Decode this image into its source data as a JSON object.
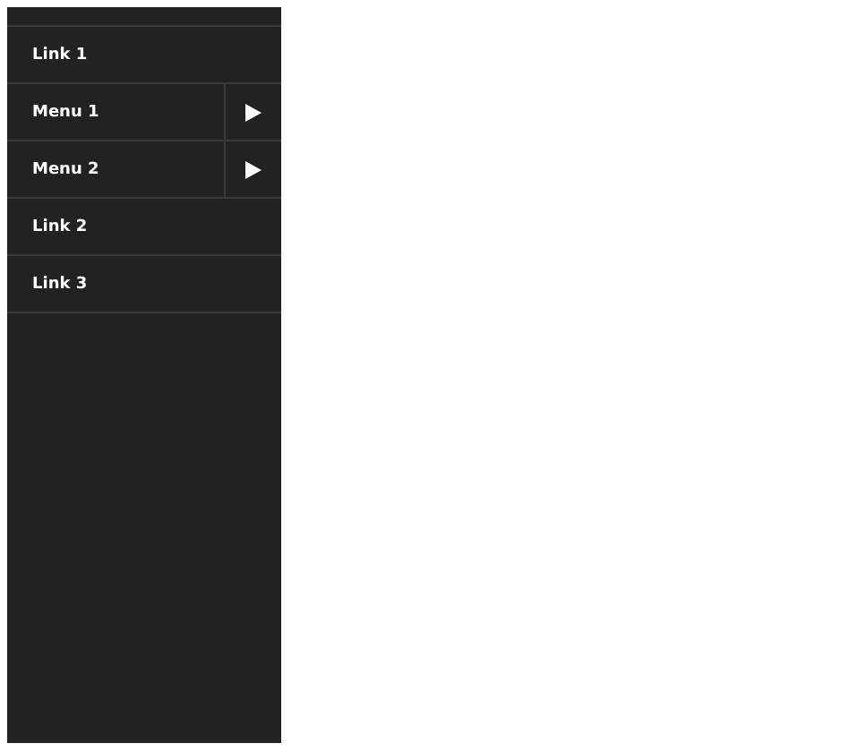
{
  "sidebar": {
    "items": [
      {
        "kind": "link",
        "label": "Link 1"
      },
      {
        "kind": "menu",
        "label": "Menu 1"
      },
      {
        "kind": "menu",
        "label": "Menu 2"
      },
      {
        "kind": "link",
        "label": "Link 2"
      },
      {
        "kind": "link",
        "label": "Link 3"
      }
    ]
  }
}
